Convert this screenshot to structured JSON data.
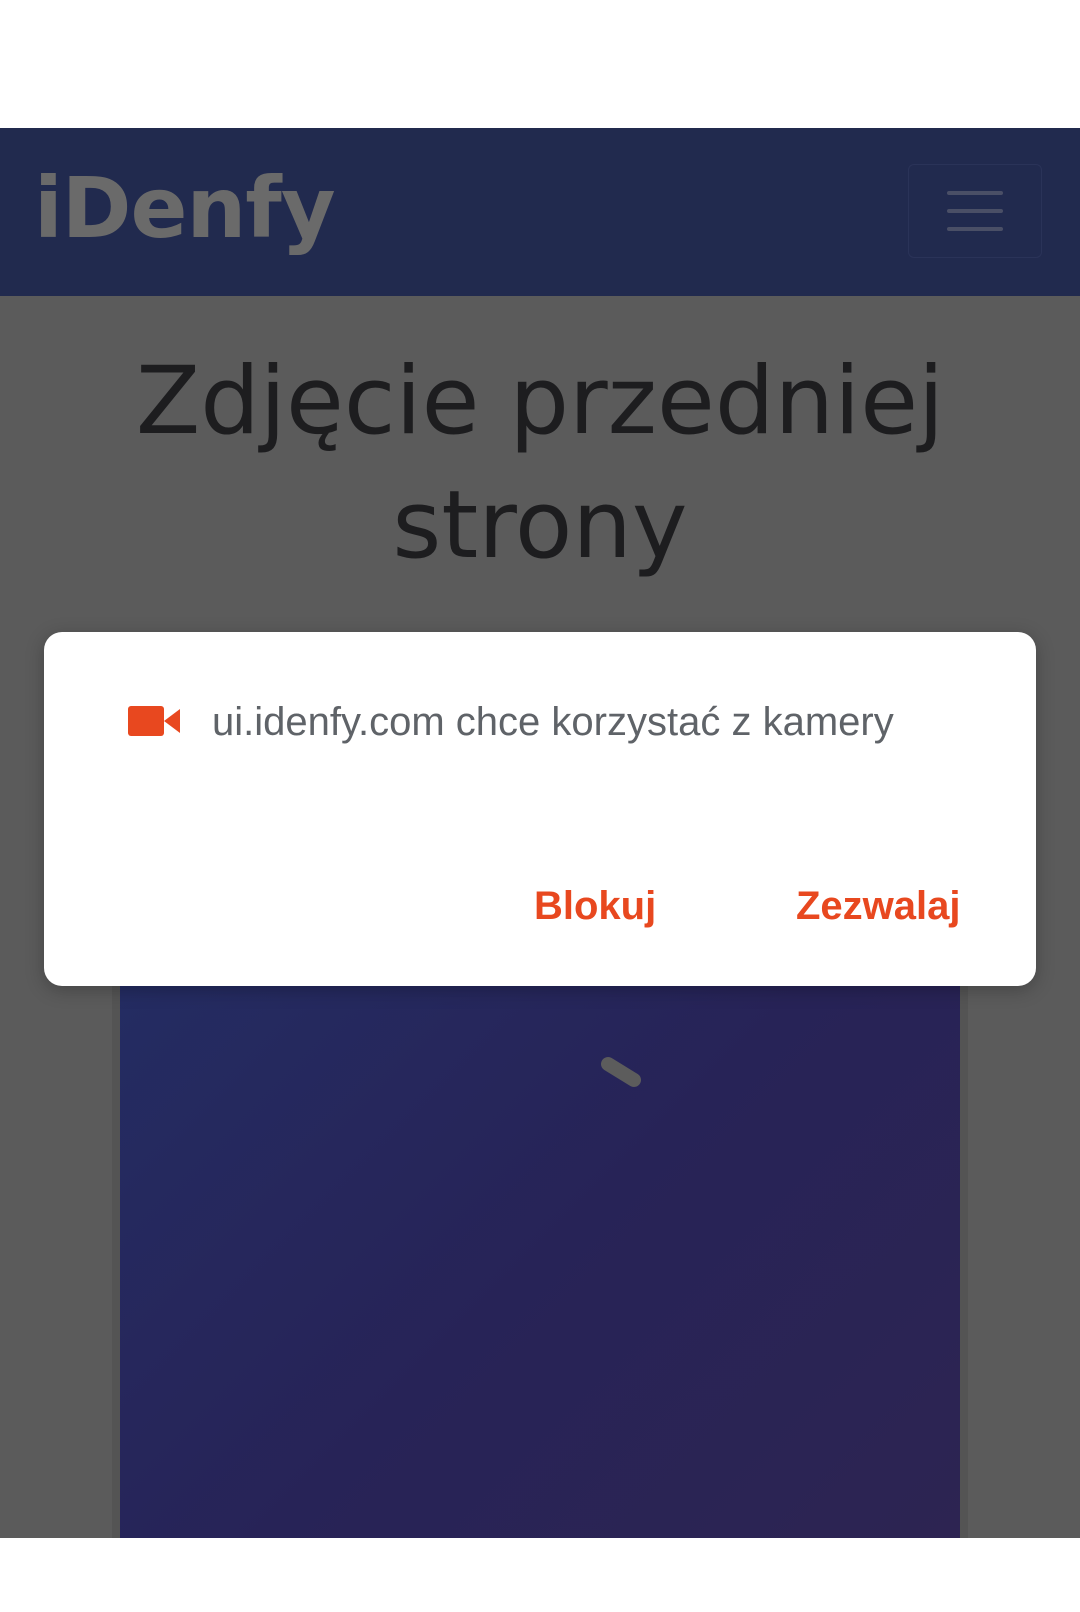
{
  "header": {
    "logo_text": "iDenfy",
    "menu_icon": "hamburger-menu-icon",
    "background_color": "#212a4e"
  },
  "main": {
    "title": "Zdjęcie przedniej strony"
  },
  "permission_dialog": {
    "icon": "video-camera-icon",
    "message": "ui.idenfy.com chce korzystać z kamery",
    "block_label": "Blokuj",
    "allow_label": "Zezwalaj",
    "accent_color": "#e8481f"
  }
}
